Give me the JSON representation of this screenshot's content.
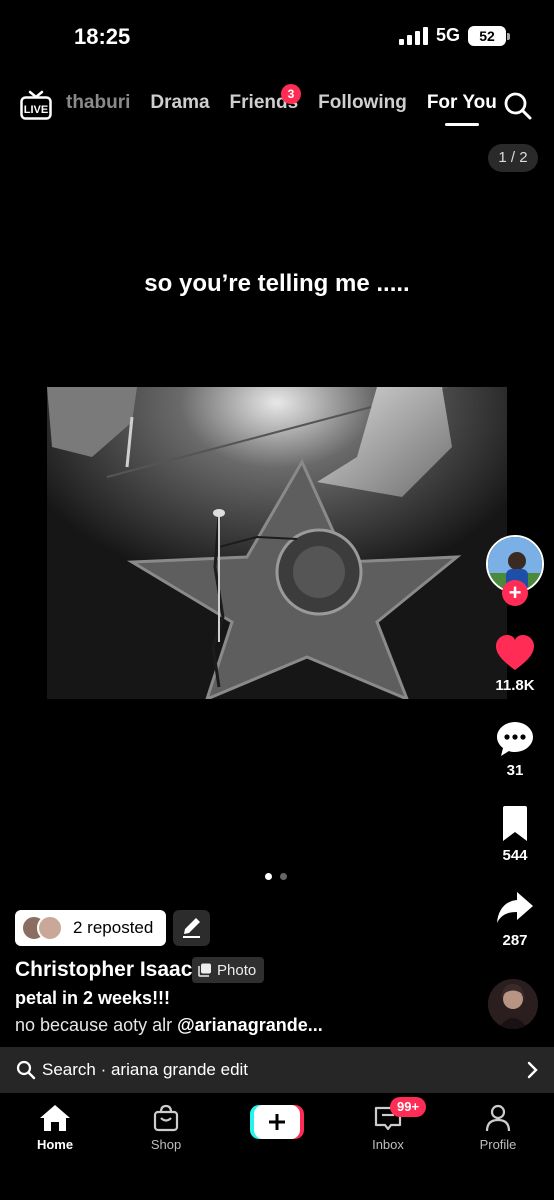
{
  "status_bar": {
    "time": "18:25",
    "network": "5G",
    "battery": "52"
  },
  "top_nav": {
    "tabs": [
      {
        "label": "thaburi",
        "state": "faded"
      },
      {
        "label": "Drama",
        "state": "normal"
      },
      {
        "label": "Friends",
        "state": "normal"
      },
      {
        "label": "Following",
        "state": "normal"
      },
      {
        "label": "For You",
        "state": "active"
      }
    ],
    "friends_badge": "3",
    "live_label": "LIVE"
  },
  "post": {
    "page_counter": "1 / 2",
    "caption": "so you’re telling me .....",
    "repost_label": "2 reposted",
    "author": "Christopher Isaac",
    "type_tag": "Photo",
    "title": "petal in 2 weeks!!!",
    "description": "no because aoty alr ",
    "mention": "@arianagrande..."
  },
  "actions": {
    "likes": "11.8K",
    "comments": "31",
    "saves": "544",
    "shares": "287"
  },
  "search_bar": {
    "text": "Search · ariana grande edit"
  },
  "bottom_nav": {
    "items": [
      "Home",
      "Shop",
      "Inbox",
      "Profile"
    ],
    "inbox_badge": "99+"
  },
  "colors": {
    "accent": "#ff2d55",
    "like": "#ff2d55",
    "create_cyan": "#25f4ee",
    "create_red": "#fe2c55"
  }
}
